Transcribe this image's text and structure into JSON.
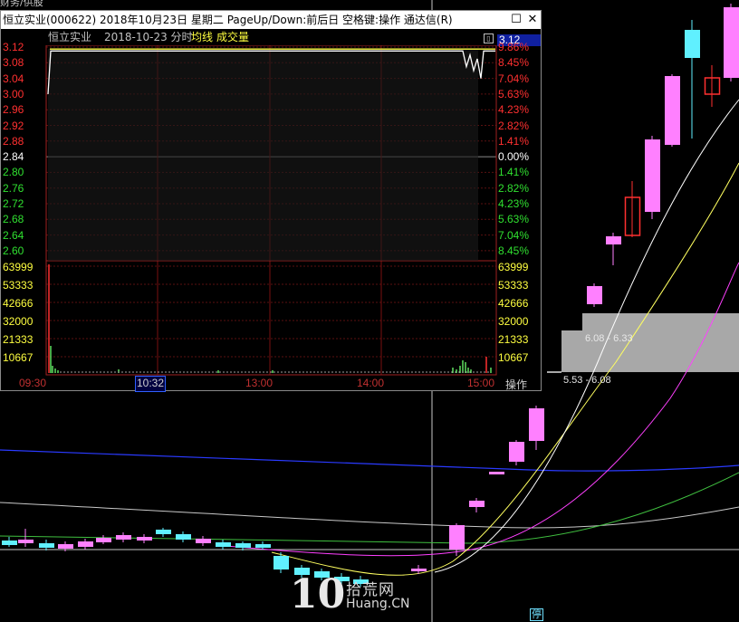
{
  "corner_text": "财务/供股",
  "window": {
    "title": "恒立实业(000622) 2018年10月23日 星期二 PageUp/Down:前后日 空格键:操作 通达信(R)",
    "minimize_glyph": "☐",
    "close_glyph": "✕"
  },
  "info_bar": {
    "stock_name": "恒立实业",
    "date_mode": "2018-10-23 分时",
    "avg_line_label": "均线",
    "volume_label": "成交量",
    "current_price": "3.12"
  },
  "price_axis_left": [
    "3.12",
    "3.08",
    "3.04",
    "3.00",
    "2.96",
    "2.92",
    "2.88",
    "2.84",
    "2.80",
    "2.76",
    "2.72",
    "2.68",
    "2.64",
    "2.60"
  ],
  "price_axis_right": [
    "9.86%",
    "8.45%",
    "7.04%",
    "5.63%",
    "4.23%",
    "2.82%",
    "1.41%",
    "0.00%",
    "1.41%",
    "2.82%",
    "4.23%",
    "5.63%",
    "7.04%",
    "8.45%"
  ],
  "volume_axis": [
    "63999",
    "53333",
    "42666",
    "32000",
    "21333",
    "10667"
  ],
  "time_axis": [
    "09:30",
    "10:32",
    "13:00",
    "14:00",
    "15:00"
  ],
  "operate_button": "操作",
  "kline_labels": {
    "range_high": "6.08 - 6.33",
    "range_low": "5.53 - 6.08",
    "limit_badge": "停"
  },
  "watermark": {
    "number": "10",
    "top_text": "拾荒网",
    "bottom_text": "Huang.CN"
  },
  "colors": {
    "up_candle": "#ff80ff",
    "down_candle": "#60f0ff",
    "price_line": "#ffffff",
    "avg_line": "#ffff40",
    "red_axis": "#ff3030",
    "green_axis": "#30e030",
    "volume_axis": "#ffff40"
  },
  "chart_data": {
    "type": "line",
    "title": "恒立实业 2018-10-23 分时",
    "x_ticks": [
      "09:30",
      "10:32",
      "13:00",
      "14:00",
      "15:00"
    ],
    "ylim": [
      2.6,
      3.12
    ],
    "prev_close": 2.84,
    "series": [
      {
        "name": "均线",
        "values": [
          3.11,
          3.11,
          3.11,
          3.11,
          3.11,
          3.11
        ]
      },
      {
        "name": "成交量",
        "values": [
          63999,
          8000,
          2000,
          3000,
          9000,
          12000
        ]
      }
    ]
  }
}
